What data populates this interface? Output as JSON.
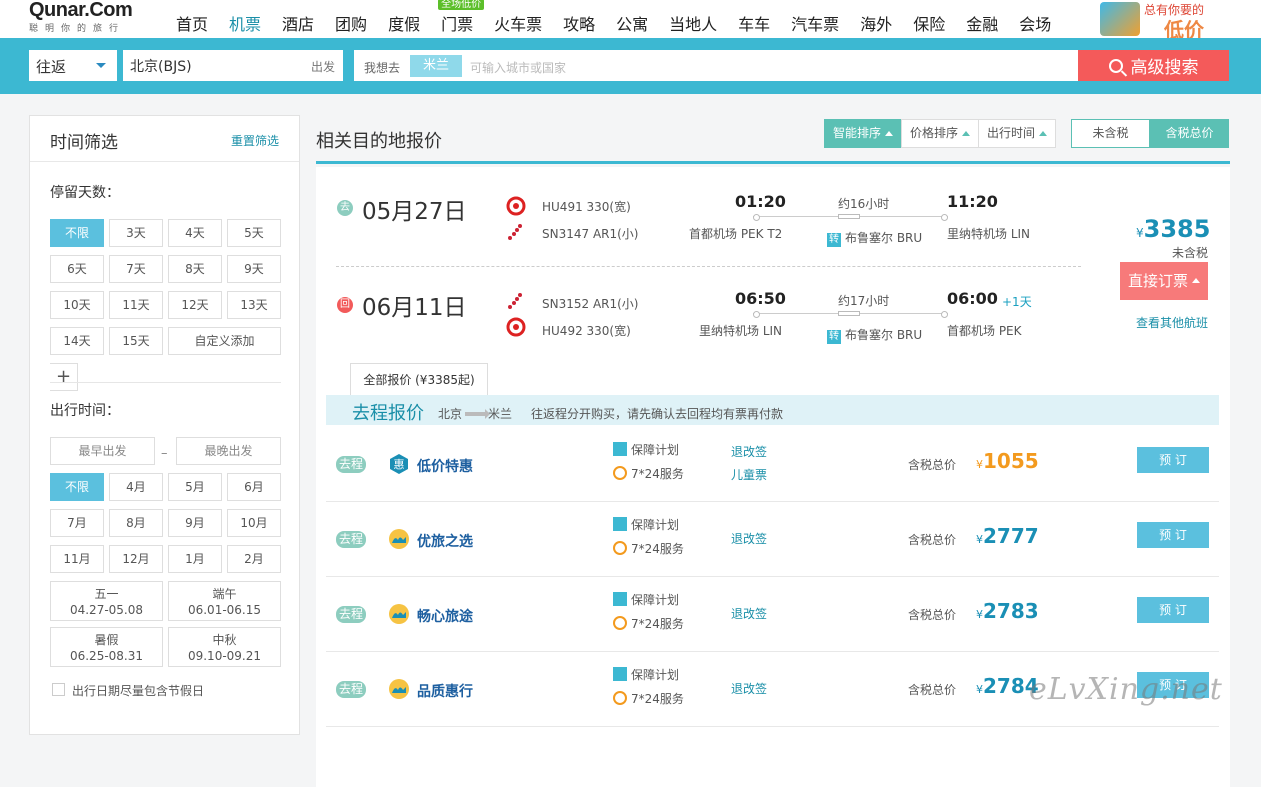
{
  "header": {
    "brand": "Qunar.Com",
    "slogan": "聪明你的旅行",
    "nav": [
      "首页",
      "机票",
      "酒店",
      "团购",
      "度假",
      "门票",
      "火车票",
      "攻略",
      "公寓",
      "当地人",
      "车车",
      "汽车票",
      "海外",
      "保险",
      "金融",
      "会场"
    ],
    "nav_tag": "全场低价",
    "promo_line1": "总有你要的",
    "promo_line2": "低价"
  },
  "search": {
    "trip_type": "往返",
    "from": "北京(BJS)",
    "from_suffix": "出发",
    "dest_label": "我想去",
    "dest_chip": "米兰",
    "dest_placeholder": "可输入城市或国家",
    "button": "高级搜索"
  },
  "sidebar": {
    "title": "时间筛选",
    "reset": "重置筛选",
    "stay_label": "停留天数：",
    "stay": [
      "不限",
      "3天",
      "4天",
      "5天",
      "6天",
      "7天",
      "8天",
      "9天",
      "10天",
      "11天",
      "12天",
      "13天",
      "14天",
      "15天"
    ],
    "custom_add": "自定义添加",
    "plus": "+",
    "depart_label": "出行时间：",
    "earliest": "最早出发",
    "latest": "最晚出发",
    "dash": "–",
    "months": [
      "不限",
      "4月",
      "5月",
      "6月",
      "7月",
      "8月",
      "9月",
      "10月",
      "11月",
      "12月",
      "1月",
      "2月"
    ],
    "holidays": [
      {
        "name": "五一",
        "range": "04.27-05.08"
      },
      {
        "name": "端午",
        "range": "06.01-06.15"
      },
      {
        "name": "暑假",
        "range": "06.25-08.31"
      },
      {
        "name": "中秋",
        "range": "09.10-09.21"
      }
    ],
    "holiday_check": "出行日期尽量包含节假日"
  },
  "main": {
    "title": "相关目的地报价",
    "sorts": [
      "智能排序",
      "价格排序",
      "出行时间"
    ],
    "tax": [
      "未含税",
      "含税总价"
    ],
    "outbound": {
      "badge": "去",
      "date": "05月27日",
      "flights": [
        "HU491 330(宽)",
        "SN3147 AR1(小)"
      ],
      "dep_time": "01:20",
      "duration": "约16小时",
      "arr_time": "11:20",
      "dep_airport": "首都机场 PEK T2",
      "transfer_mark": "转",
      "transfer": "布鲁塞尔 BRU",
      "arr_airport": "里纳特机场 LIN"
    },
    "inbound": {
      "badge": "回",
      "date": "06月11日",
      "flights": [
        "SN3152 AR1(小)",
        "HU492 330(宽)"
      ],
      "dep_time": "06:50",
      "duration": "约17小时",
      "arr_time": "06:00",
      "plus_day": "+1天",
      "dep_airport": "里纳特机场 LIN",
      "transfer_mark": "转",
      "transfer": "布鲁塞尔 BRU",
      "arr_airport": "首都机场 PEK"
    },
    "price_currency": "¥",
    "price": "3385",
    "price_note": "未含税",
    "book": "直接订票",
    "other": "查看其他航班",
    "all_tab": "全部报价 (¥3385起)",
    "out_title": "去程报价",
    "route_from": "北京",
    "route_to": "米兰",
    "route_tip": "往返程分开购买，请先确认去回程均有票再付款",
    "offers": [
      {
        "tag": "去程",
        "name": "低价特惠",
        "g1": "保障计划",
        "g2": "7*24服务",
        "l1": "退改签",
        "l2": "儿童票",
        "tot": "含税总价",
        "cur": "¥",
        "amt": "1055",
        "btn": "预 订"
      },
      {
        "tag": "去程",
        "name": "优旅之选",
        "g1": "保障计划",
        "g2": "7*24服务",
        "l1": "退改签",
        "l2": "",
        "tot": "含税总价",
        "cur": "¥",
        "amt": "2777",
        "btn": "预 订"
      },
      {
        "tag": "去程",
        "name": "畅心旅途",
        "g1": "保障计划",
        "g2": "7*24服务",
        "l1": "退改签",
        "l2": "",
        "tot": "含税总价",
        "cur": "¥",
        "amt": "2783",
        "btn": "预 订"
      },
      {
        "tag": "去程",
        "name": "品质惠行",
        "g1": "保障计划",
        "g2": "7*24服务",
        "l1": "退改签",
        "l2": "",
        "tot": "含税总价",
        "cur": "¥",
        "amt": "2784",
        "btn": "预 订"
      }
    ]
  },
  "watermark": "eLvXing.net"
}
